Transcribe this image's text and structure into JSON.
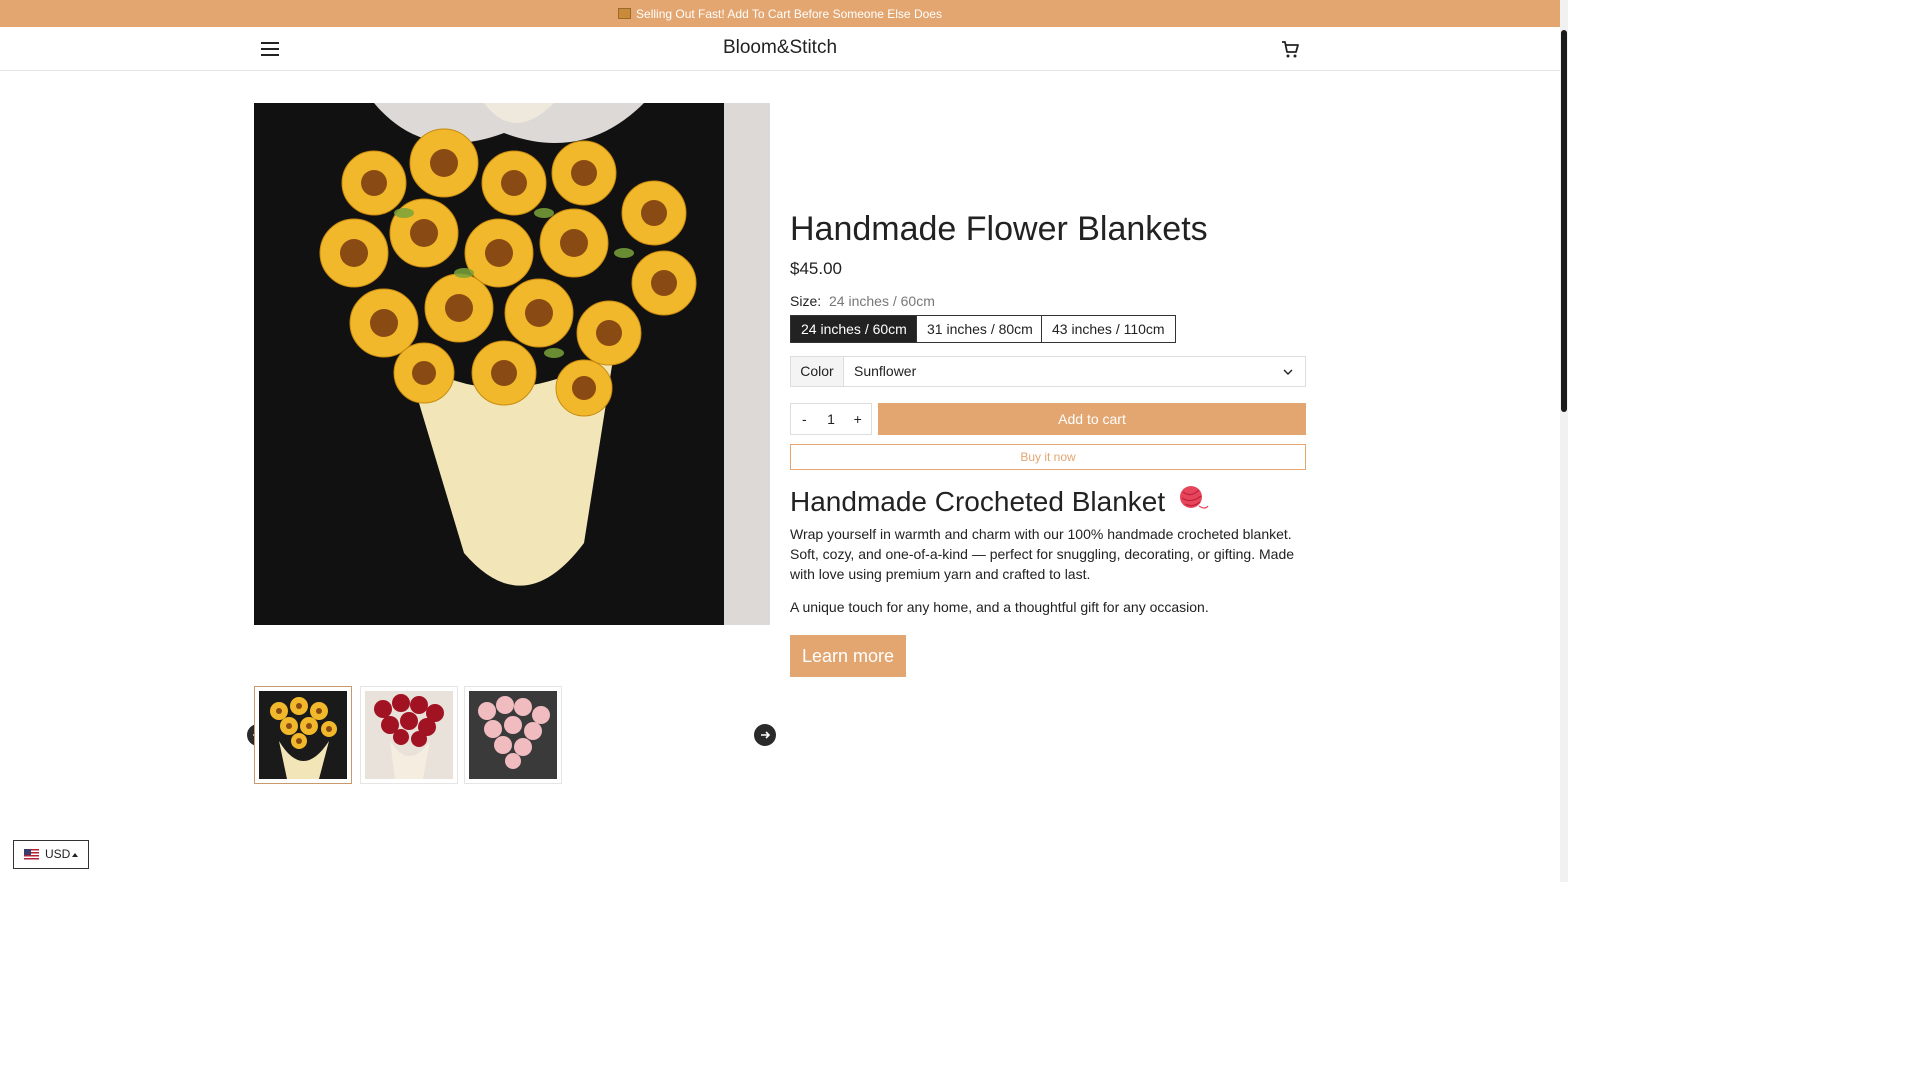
{
  "announcement": {
    "icon": "package-icon",
    "text": "Selling Out Fast! Add To Cart Before Someone Else Does"
  },
  "header": {
    "brand": "Bloom&Stitch",
    "menu_icon": "hamburger-icon",
    "cart_icon": "cart-icon"
  },
  "colors": {
    "accent": "#e3a670",
    "dark": "#222222",
    "announce_text": "#ffffff"
  },
  "product": {
    "title": "Handmade Flower Blankets",
    "price": "$45.00",
    "size_label": "Size:",
    "size_selected": "24 inches / 60cm",
    "sizes": [
      "24 inches / 60cm",
      "31 inches / 80cm",
      "43 inches / 110cm"
    ],
    "color_label": "Color",
    "color_value": "Sunflower",
    "qty_minus": "-",
    "qty_value": "1",
    "qty_plus": "+",
    "add_to_cart": "Add to cart",
    "buy_now": "Buy it now",
    "subheading": "Handmade Crocheted Blanket",
    "subheading_icon": "yarn-ball-icon",
    "description": [
      "Wrap yourself in warmth and charm with our 100% handmade crocheted blanket. Soft, cozy, and one-of-a-kind — perfect for snuggling, decorating, or gifting. Made with love using premium yarn and crafted to last.",
      "A unique touch for any home, and a thoughtful gift for any occasion."
    ],
    "learn_more": "Learn more"
  },
  "gallery": {
    "main_image": "sunflower-bouquet-blanket",
    "thumbnails": [
      "sunflower-bouquet",
      "red-rose-bouquet",
      "pink-rose-bouquet"
    ],
    "prev_icon": "arrow-left-icon",
    "next_icon": "arrow-right-icon"
  },
  "currency": {
    "flag": "us-flag-icon",
    "code": "USD"
  }
}
